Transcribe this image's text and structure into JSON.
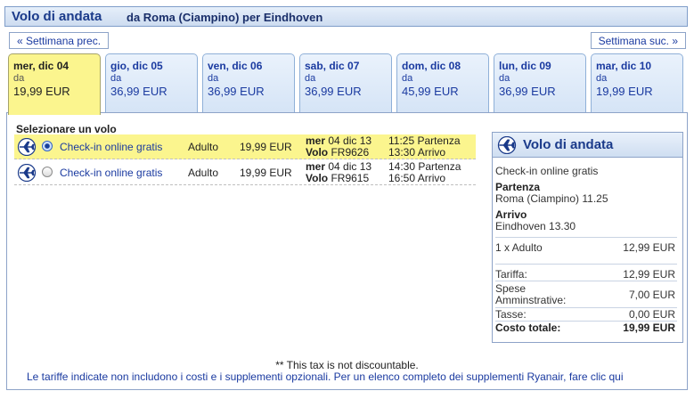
{
  "header": {
    "title": "Volo di andata",
    "route": "da Roma (Ciampino) per Eindhoven"
  },
  "week_nav": {
    "prev_label": "« Settimana prec.",
    "next_label": "Settimana suc. »"
  },
  "day_tabs": [
    {
      "day": "mer, dic 04",
      "from_label": "da",
      "price": "19,99 EUR",
      "selected": true
    },
    {
      "day": "gio, dic 05",
      "from_label": "da",
      "price": "36,99 EUR",
      "selected": false
    },
    {
      "day": "ven, dic 06",
      "from_label": "da",
      "price": "36,99 EUR",
      "selected": false
    },
    {
      "day": "sab, dic 07",
      "from_label": "da",
      "price": "36,99 EUR",
      "selected": false
    },
    {
      "day": "dom, dic 08",
      "from_label": "da",
      "price": "45,99 EUR",
      "selected": false
    },
    {
      "day": "lun, dic 09",
      "from_label": "da",
      "price": "36,99 EUR",
      "selected": false
    },
    {
      "day": "mar, dic 10",
      "from_label": "da",
      "price": "19,99 EUR",
      "selected": false
    }
  ],
  "flight_list": {
    "heading": "Selezionare un volo",
    "flights": [
      {
        "fare_type": "Check-in online gratis",
        "passenger": "Adulto",
        "price": "19,99 EUR",
        "date_label": "mer",
        "date": "04 dic 13",
        "flight_label": "Volo",
        "flight_number": "FR9626",
        "departure": "11:25 Partenza",
        "arrival": "13:30 Arrivo",
        "selected": true
      },
      {
        "fare_type": "Check-in online gratis",
        "passenger": "Adulto",
        "price": "19,99 EUR",
        "date_label": "mer",
        "date": "04 dic 13",
        "flight_label": "Volo",
        "flight_number": "FR9615",
        "departure": "14:30 Partenza",
        "arrival": "16:50 Arrivo",
        "selected": false
      }
    ]
  },
  "summary": {
    "title": "Volo di andata",
    "fare_type": "Check-in online gratis",
    "departure_label": "Partenza",
    "departure_value": "Roma (Ciampino) 11.25",
    "arrival_label": "Arrivo",
    "arrival_value": "Eindhoven 13.30",
    "pax_label": "1 x Adulto",
    "pax_value": "12,99 EUR",
    "fare_label": "Tariffa:",
    "fare_value": "12,99 EUR",
    "admin_label_1": "Spese",
    "admin_label_2": "Amminstrative:",
    "admin_value": "7,00 EUR",
    "tax_label": "Tasse:",
    "tax_value": "0,00 EUR",
    "total_label": "Costo totale:",
    "total_value": "19,99 EUR"
  },
  "notes": {
    "tax_note": "** This tax is not discountable.",
    "footnote": "Le tariffe indicate non includono i costi e i supplementi opzionali. Per un elenco completo dei supplementi Ryanair, fare clic qui"
  },
  "colors": {
    "accent": "#1a3aa0",
    "selected_bg": "#fbf58e",
    "border": "#8da3c8"
  },
  "icons": {
    "flight_row": "airplane-icon",
    "summary": "airplane-circle-icon"
  }
}
